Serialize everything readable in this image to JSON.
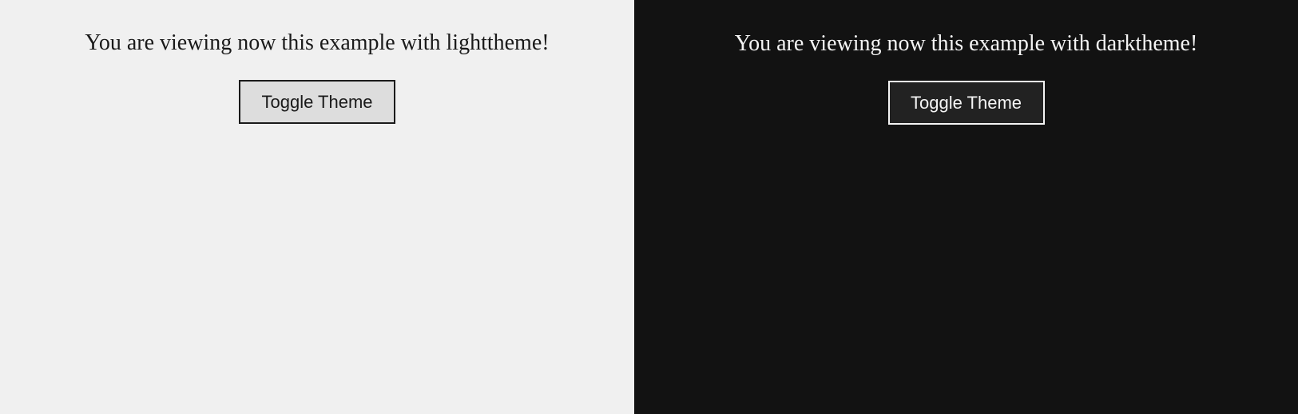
{
  "light_panel": {
    "message": "You are viewing now this example with lighttheme!",
    "button_label": "Toggle Theme",
    "background": "#f0f0f0",
    "text_color": "#1a1a1a",
    "button_background": "#dddddd"
  },
  "dark_panel": {
    "message": "You are viewing now this example with darktheme!",
    "button_label": "Toggle Theme",
    "background": "#121212",
    "text_color": "#f4f4f4",
    "button_background": "#222222"
  }
}
